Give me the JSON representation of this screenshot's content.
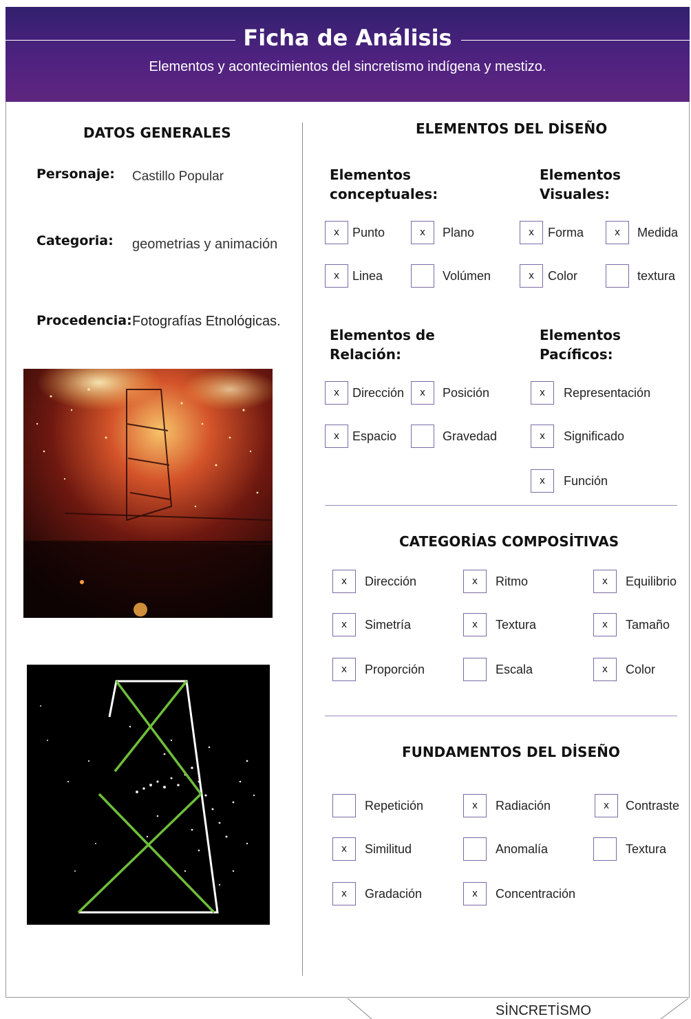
{
  "header": {
    "title": "Ficha de Análisis",
    "subtitle": "Elementos y acontecimientos del sincretismo indígena y mestizo."
  },
  "datos_generales": {
    "heading": "DATOS GENERALES",
    "personaje_label": "Personaje:",
    "personaje_value": "Castillo Popular",
    "categoria_label": "Categoria:",
    "categoria_value": "geometrias y animación",
    "procedencia_label": "Procedencia:",
    "procedencia_value": "Fotografías Etnológicas."
  },
  "elementos_diseno": {
    "heading": "ELEMENTOS DEL DİSEÑO",
    "conceptuales": {
      "title_line1": "Elementos",
      "title_line2": "conceptuales:",
      "items": [
        {
          "label": "Punto",
          "mark": "x"
        },
        {
          "label": "Plano",
          "mark": "x"
        },
        {
          "label": "Linea",
          "mark": "x"
        },
        {
          "label": "Volúmen",
          "mark": ""
        }
      ]
    },
    "visuales": {
      "title_line1": "Elementos",
      "title_line2": "Visuales:",
      "items": [
        {
          "label": "Forma",
          "mark": "x"
        },
        {
          "label": "Medida",
          "mark": "x"
        },
        {
          "label": "Color",
          "mark": "x"
        },
        {
          "label": "textura",
          "mark": ""
        }
      ]
    },
    "relacion": {
      "title_line1": "Elementos de",
      "title_line2": "Relación:",
      "items": [
        {
          "label": "Dirección",
          "mark": "x"
        },
        {
          "label": "Posición",
          "mark": "x"
        },
        {
          "label": "Espacio",
          "mark": "x"
        },
        {
          "label": "Gravedad",
          "mark": ""
        }
      ]
    },
    "pacificos": {
      "title_line1": "Elementos",
      "title_line2": "Pacíficos:",
      "items": [
        {
          "label": "Representación",
          "mark": "x"
        },
        {
          "label": "Significado",
          "mark": "x"
        },
        {
          "label": "Función",
          "mark": "x"
        }
      ]
    }
  },
  "categorias_compositivas": {
    "heading": "CATEGORİAS COMPOSİTIVAS",
    "items": [
      {
        "label": "Dirección",
        "mark": "x"
      },
      {
        "label": "Ritmo",
        "mark": "x"
      },
      {
        "label": "Equilibrio",
        "mark": "x"
      },
      {
        "label": "Simetría",
        "mark": "x"
      },
      {
        "label": "Textura",
        "mark": "x"
      },
      {
        "label": "Tamaño",
        "mark": "x"
      },
      {
        "label": "Proporción",
        "mark": "x"
      },
      {
        "label": "Escala",
        "mark": ""
      },
      {
        "label": "Color",
        "mark": "x"
      }
    ]
  },
  "fundamentos_diseno": {
    "heading": "FUNDAMENTOS DEL DİSEÑO",
    "items": [
      {
        "label": "Repetición",
        "mark": ""
      },
      {
        "label": "Radiación",
        "mark": "x"
      },
      {
        "label": "Contraste",
        "mark": "x"
      },
      {
        "label": "Similitud",
        "mark": "x"
      },
      {
        "label": "Anomalía",
        "mark": ""
      },
      {
        "label": "Textura",
        "mark": ""
      },
      {
        "label": "Gradación",
        "mark": "x"
      },
      {
        "label": "Concentración",
        "mark": "x"
      }
    ]
  },
  "images": {
    "photo_icon": "fireworks-castle-photo",
    "sketch_icon": "geometric-analysis-sketch",
    "sketch_line_color": "#6fbf3a"
  },
  "footer": {
    "text": "SİNCRETİSMO"
  },
  "colors": {
    "header_start": "#32206e",
    "header_end": "#5e2680",
    "checkbox_border": "#7a6aa6"
  }
}
